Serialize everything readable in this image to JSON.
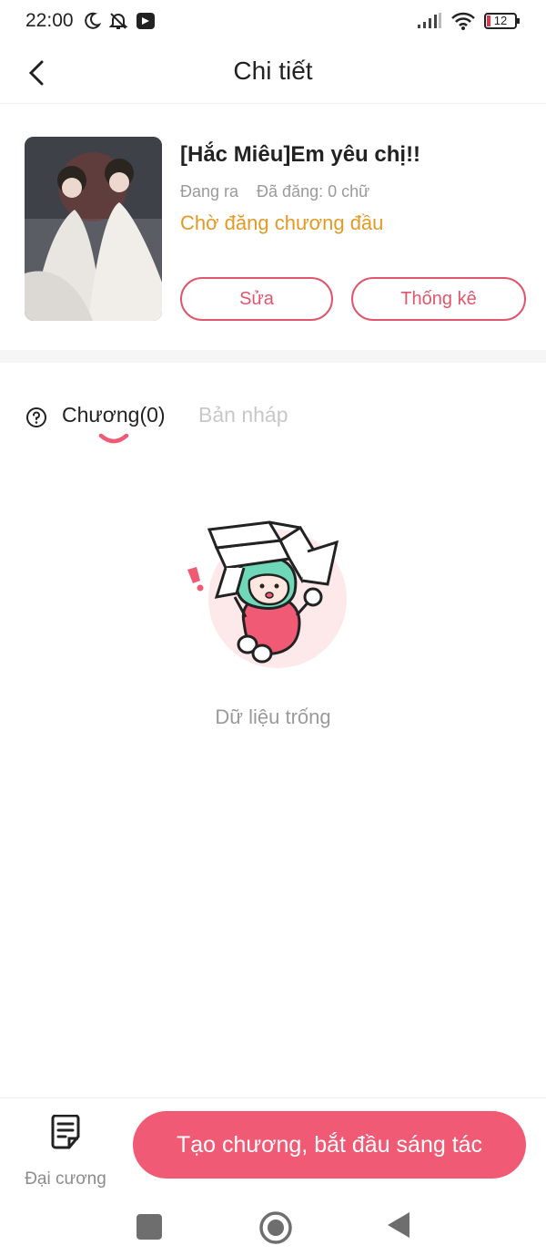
{
  "status_bar": {
    "time": "22:00",
    "battery": "12",
    "icons": [
      "moon-icon",
      "bell-off-icon",
      "app-notification-icon",
      "signal-icon",
      "wifi-icon",
      "battery-icon"
    ]
  },
  "header": {
    "title": "Chi tiết",
    "back_icon": "chevron-left-icon"
  },
  "book": {
    "title": "[Hắc Miêu]Em yêu chị!!",
    "state": "Đang ra",
    "published": "Đã đăng: 0 chữ",
    "status": "Chờ đăng chương đầu",
    "edit_label": "Sửa",
    "stats_label": "Thống kê"
  },
  "tabs": {
    "chapters": "Chương(0)",
    "drafts": "Bản nháp"
  },
  "empty_state": {
    "text": "Dữ liệu trống"
  },
  "bottom_bar": {
    "outline_label": "Đại cương",
    "create_label": "Tạo chương, bắt đầu sáng tác"
  },
  "colors": {
    "accent": "#f05a74",
    "outline_accent": "#e0566c",
    "status_orange": "#e39a25",
    "muted_text": "#9a9a9a"
  }
}
